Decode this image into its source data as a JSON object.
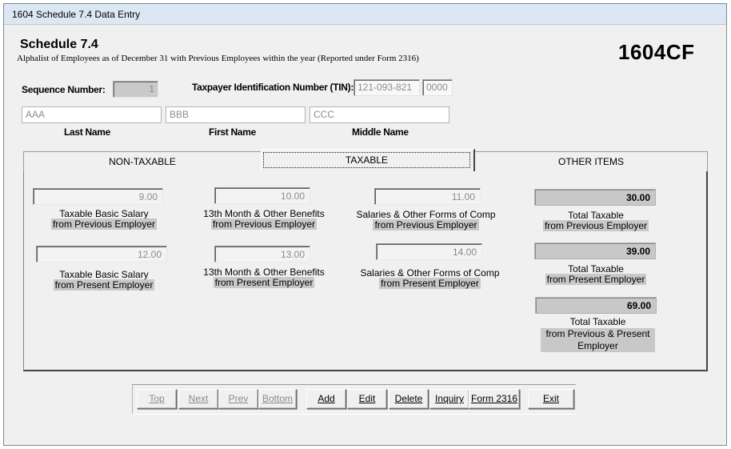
{
  "window": {
    "title": "1604 Schedule 7.4 Data Entry"
  },
  "header": {
    "schedule_title": "Schedule  7.4",
    "subtitle": "Alphalist of Employees as of December 31 with Previous Employees within the year (Reported under Form 2316)",
    "form_code": "1604CF"
  },
  "identity": {
    "sequence_label": "Sequence Number:",
    "sequence_value": "1",
    "tin_label": "Taxpayer Identification Number (TIN):",
    "tin_value": "121-093-821",
    "tin_branch": "0000",
    "last_name_value": "AAA",
    "first_name_value": "BBB",
    "middle_name_value": "CCC",
    "last_name_label": "Last Name",
    "first_name_label": "First Name",
    "middle_name_label": "Middle Name"
  },
  "tabs": [
    {
      "label": "NON-TAXABLE",
      "active": false
    },
    {
      "label": "TAXABLE",
      "active": true
    },
    {
      "label": "OTHER ITEMS",
      "active": false
    }
  ],
  "taxable": {
    "prev_basic_salary": {
      "value": "9.00",
      "caption1": "Taxable Basic Salary",
      "caption2": "from Previous Employer"
    },
    "prev_13th_month": {
      "value": "10.00",
      "caption1": "13th Month & Other Benefits",
      "caption2": "from Previous Employer"
    },
    "prev_salaries_other": {
      "value": "11.00",
      "caption1": "Salaries & Other Forms of Comp",
      "caption2": "from Previous Employer"
    },
    "prev_total": {
      "value": "30.00",
      "caption1": "Total Taxable",
      "caption2": "from Previous Employer"
    },
    "pres_basic_salary": {
      "value": "12.00",
      "caption1": "Taxable Basic Salary",
      "caption2": "from Present Employer"
    },
    "pres_13th_month": {
      "value": "13.00",
      "caption1": "13th Month & Other Benefits",
      "caption2": "from Present Employer"
    },
    "pres_salaries_other": {
      "value": "14.00",
      "caption1": "Salaries & Other Forms of Comp",
      "caption2": "from Present Employer"
    },
    "pres_total": {
      "value": "39.00",
      "caption1": "Total Taxable",
      "caption2": "from Present Employer"
    },
    "grand_total": {
      "value": "69.00",
      "caption1": "Total Taxable",
      "caption2": "from Previous & Present",
      "caption3": "Employer"
    }
  },
  "buttons": {
    "top": "Top",
    "next": "Next",
    "prev": "Prev",
    "bottom": "Bottom",
    "add": "Add",
    "edit": "Edit",
    "delete": "Delete",
    "inquiry": "Inquiry",
    "form2316": "Form 2316",
    "exit": "Exit"
  }
}
